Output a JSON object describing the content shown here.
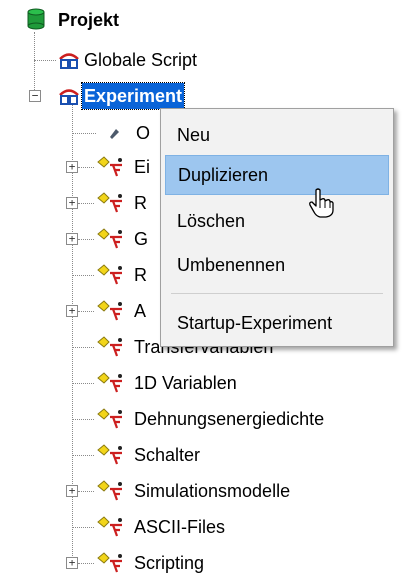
{
  "tree": {
    "root_label": "Projekt",
    "global_script_label": "Globale Script",
    "experiment_label": "Experiment",
    "first_child_partial": "O",
    "children_partial": [
      "Ei",
      "R",
      "G",
      "R",
      "A"
    ],
    "transfer_label": "Transfervariablen",
    "items": [
      {
        "label": "1D Variablen"
      },
      {
        "label": "Dehnungsenergiedichte"
      },
      {
        "label": "Schalter"
      },
      {
        "label": "Simulationsmodelle"
      },
      {
        "label": "ASCII-Files"
      },
      {
        "label": "Scripting"
      }
    ]
  },
  "context_menu": {
    "items": [
      {
        "label": "Neu"
      },
      {
        "label": "Duplizieren",
        "highlighted": true
      },
      {
        "label": "Löschen"
      },
      {
        "label": "Umbenennen"
      },
      {
        "label": "Startup-Experiment"
      }
    ]
  },
  "colors": {
    "selection": "#0a64d8",
    "menu_highlight": "#9dc6ef",
    "icon_yellow": "#f2d51a",
    "icon_red": "#cc1f1f",
    "db_green": "#1f9b3a"
  },
  "icons": [
    "database-icon",
    "experiment-icon",
    "variable-icon",
    "pin-icon",
    "hand-cursor-icon"
  ]
}
